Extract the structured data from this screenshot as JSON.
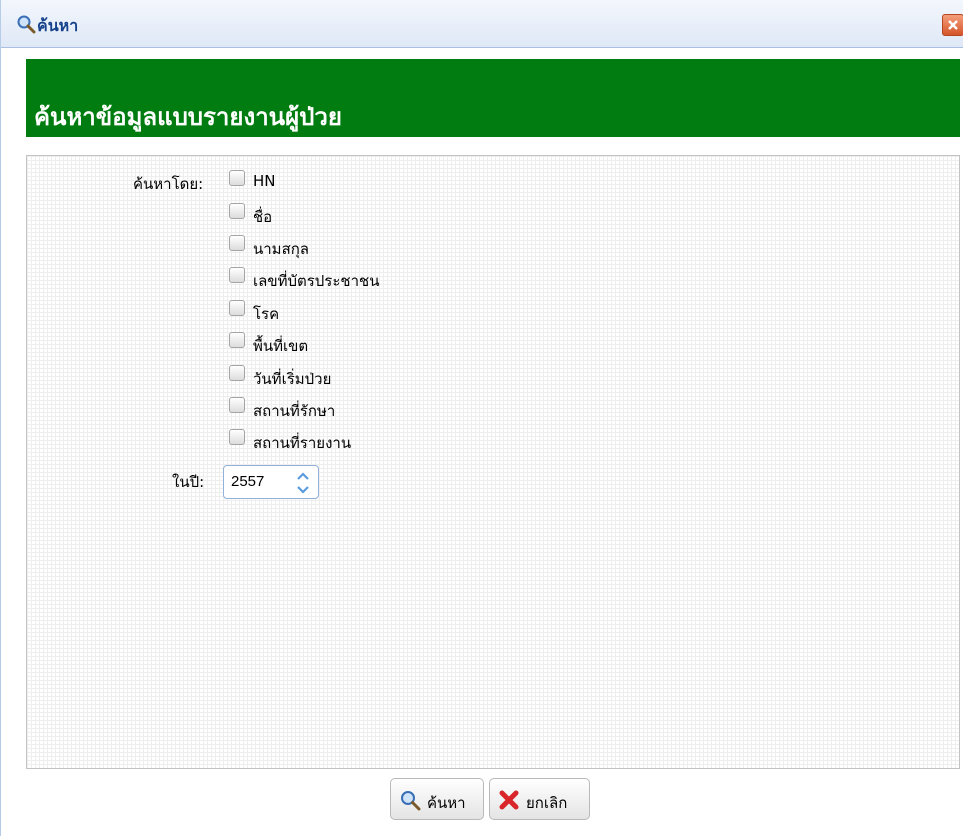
{
  "window": {
    "title": "ค้นหา",
    "title_icon": "search-icon",
    "close_icon": "close-icon"
  },
  "header": {
    "title": "ค้นหาข้อมูลแบบรายงานผู้ป่วย",
    "background_color": "#007c10"
  },
  "form": {
    "search_by_label": "ค้นหาโดย:",
    "options": [
      {
        "label": "HN",
        "checked": false
      },
      {
        "label": "ชื่อ",
        "checked": false
      },
      {
        "label": "นามสกุล",
        "checked": false
      },
      {
        "label": "เลขที่บัตรประชาชน",
        "checked": false
      },
      {
        "label": "โรค",
        "checked": false
      },
      {
        "label": "พื้นที่เขต",
        "checked": false
      },
      {
        "label": "วันที่เริ่มป่วย",
        "checked": false
      },
      {
        "label": "สถานที่รักษา",
        "checked": false
      },
      {
        "label": "สถานที่รายงาน",
        "checked": false
      }
    ],
    "year_label": "ในปี:",
    "year_value": "2557"
  },
  "buttons": {
    "search_label": "ค้นหา",
    "search_icon": "search-icon",
    "cancel_label": "ยกเลิก",
    "cancel_icon": "x-icon"
  }
}
